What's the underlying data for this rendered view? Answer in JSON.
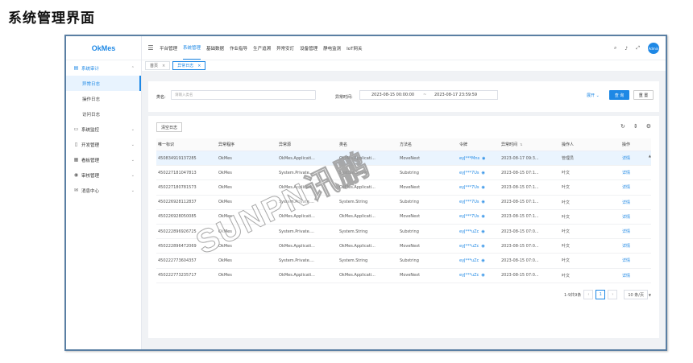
{
  "page_title": "系统管理界面",
  "app": {
    "logo": "OkMes",
    "avatar_text": "Admin"
  },
  "sidebar": {
    "items": [
      {
        "label": "系统审计",
        "icon": "clipboard-icon",
        "open": true,
        "children": [
          {
            "label": "异常日志",
            "active": true
          },
          {
            "label": "操作日志"
          },
          {
            "label": "访问日志"
          }
        ]
      },
      {
        "label": "系统监控",
        "icon": "monitor-icon"
      },
      {
        "label": "开发管理",
        "icon": "file-icon"
      },
      {
        "label": "看板管理",
        "icon": "board-icon"
      },
      {
        "label": "审核管理",
        "icon": "audit-icon"
      },
      {
        "label": "消息中心",
        "icon": "message-icon"
      }
    ]
  },
  "topmenu": [
    "平台管理",
    "系统管理",
    "基础数据",
    "作业指导",
    "生产追溯",
    "异常安灯",
    "设备管理",
    "静电监测",
    "IoT网关"
  ],
  "topmenu_active": 1,
  "tabs": [
    {
      "label": "首页"
    },
    {
      "label": "异常日志",
      "active": true
    }
  ],
  "search": {
    "class_label": "类名:",
    "class_placeholder": "请输入类名",
    "time_label": "异常时间:",
    "date_start": "2023-08-15 00:00:00",
    "date_sep": "~",
    "date_end": "2023-08-17 23:59:59",
    "expand": "展开",
    "query": "查 询",
    "reset": "重 置"
  },
  "table": {
    "clear_button": "清空日志",
    "columns": [
      "唯一标识",
      "异常程序",
      "异常源",
      "类名",
      "方法名",
      "令牌",
      "异常时间",
      "操作人",
      "操作"
    ],
    "rows": [
      [
        "450834919137285",
        "OkMes",
        "OkMes.Applicati...",
        "OkMes.Applicati...",
        "MoveNext",
        "eyJ***Mns",
        "2023-08-17 09:3...",
        "管理员",
        "详情"
      ],
      [
        "450227181047813",
        "OkMes",
        "System.Private....",
        "System.String",
        "Substring",
        "eyJ***7Us",
        "2023-08-15 07:1...",
        "叶文",
        "详情"
      ],
      [
        "450227180781573",
        "OkMes",
        "OkMes.Applicati...",
        "OkMes.Applicati...",
        "MoveNext",
        "eyJ***7Us",
        "2023-08-15 07:1...",
        "叶文",
        "详情"
      ],
      [
        "450226928112837",
        "OkMes",
        "System.Private....",
        "System.String",
        "Substring",
        "eyJ***7Us",
        "2023-08-15 07:1...",
        "叶文",
        "详情"
      ],
      [
        "450226928050085",
        "OkMes",
        "OkMes.Applicati...",
        "OkMes.Applicati...",
        "MoveNext",
        "eyJ***7Us",
        "2023-08-15 07:1...",
        "叶文",
        "详情"
      ],
      [
        "450222896926725",
        "OkMes",
        "System.Private....",
        "System.String",
        "Substring",
        "eyJ***uZc",
        "2023-08-15 07:0...",
        "叶文",
        "详情"
      ],
      [
        "450222896472069",
        "OkMes",
        "OkMes.Applicati...",
        "OkMes.Applicati...",
        "MoveNext",
        "eyJ***uZc",
        "2023-08-15 07:0...",
        "叶文",
        "详情"
      ],
      [
        "450222773604357",
        "OkMes",
        "System.Private....",
        "System.String",
        "Substring",
        "eyJ***uZc",
        "2023-08-15 07:0...",
        "叶文",
        "详情"
      ],
      [
        "450222773235717",
        "OkMes",
        "OkMes.Applicati...",
        "OkMes.Applicati...",
        "MoveNext",
        "eyJ***uZc",
        "2023-08-15 07:0...",
        "叶文",
        "详情"
      ]
    ],
    "highlight_row": 0
  },
  "pager": {
    "summary": "1-9共9条",
    "current": "1",
    "page_size": "10 条/页"
  },
  "watermark": "SUNPN讯鹏",
  "colors": {
    "accent": "#1e88e5",
    "frame": "#5a7fa3",
    "content_bg": "#f0f2f5"
  }
}
